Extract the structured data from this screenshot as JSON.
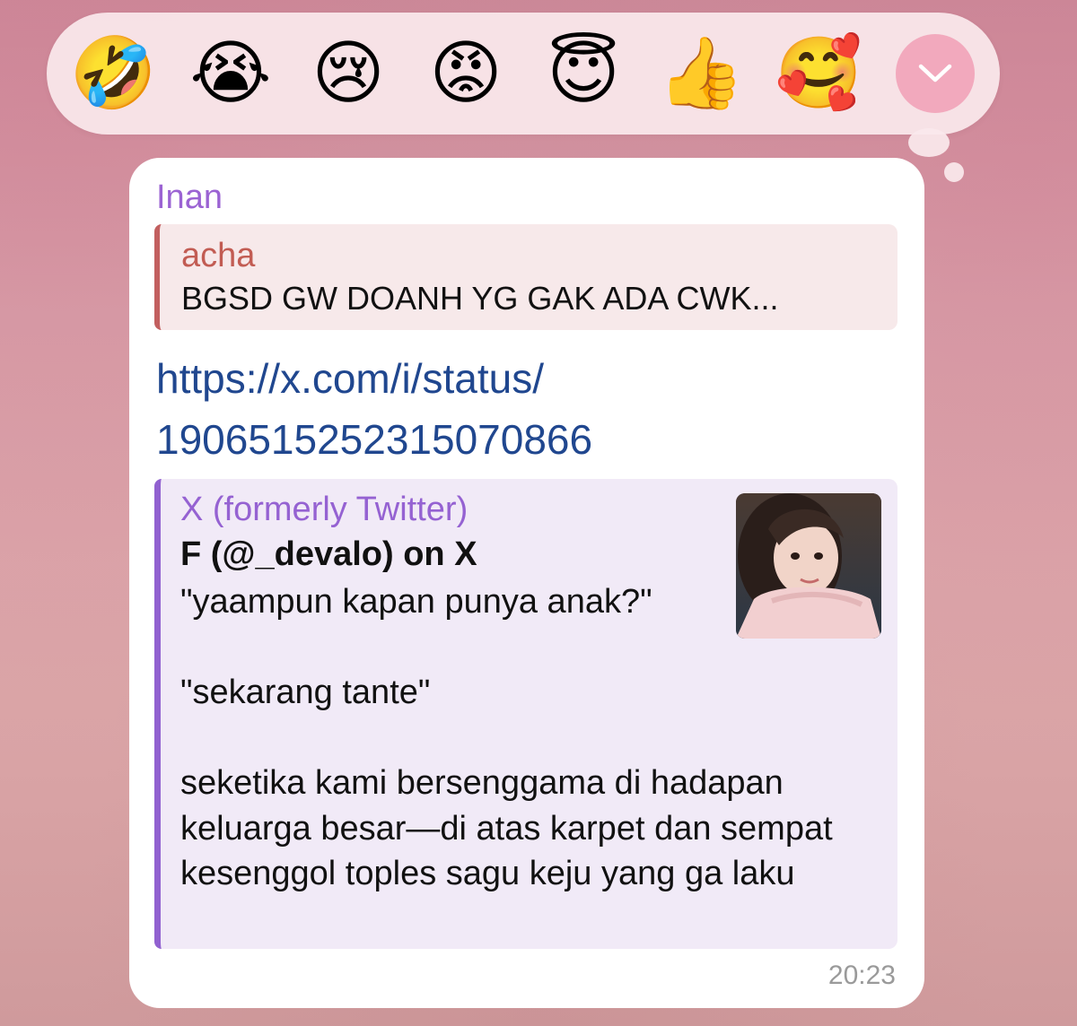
{
  "reactions": [
    {
      "emoji": "🤣",
      "icon": "rolling-on-floor-laughing"
    },
    {
      "emoji": "😭",
      "icon": "loudly-crying"
    },
    {
      "emoji": "😢",
      "icon": "crying"
    },
    {
      "emoji": "😡",
      "icon": "pouting-angry"
    },
    {
      "emoji": "😇",
      "icon": "smiling-with-halo"
    },
    {
      "emoji": "👍",
      "icon": "thumbs-up"
    },
    {
      "emoji": "🥰",
      "icon": "smiling-with-hearts"
    }
  ],
  "expand_icon": "chevron-down",
  "message": {
    "sender": "Inan",
    "reply": {
      "author": "acha",
      "text": "BGSD GW DOANH YG GAK ADA CWK..."
    },
    "link_lines": [
      "https://x.com/i/status/",
      "1906515252315070866"
    ],
    "preview": {
      "site": "X (formerly Twitter)",
      "title": "F (@_devalo) on X",
      "paragraphs": [
        "\"yaampun kapan punya anak?\"",
        "\"sekarang tante\"",
        "seketika kami bersenggama di hadapan keluarga besar—di atas karpet dan sempat kesenggol toples sagu keju yang ga laku"
      ],
      "thumbnail": "profile-photo"
    },
    "time": "20:23"
  },
  "colors": {
    "sender": "#9b63d3",
    "reply_accent": "#c25f5f",
    "link": "#20478f",
    "preview_accent": "#9161d0",
    "expand_button": "#f2a9bd"
  }
}
